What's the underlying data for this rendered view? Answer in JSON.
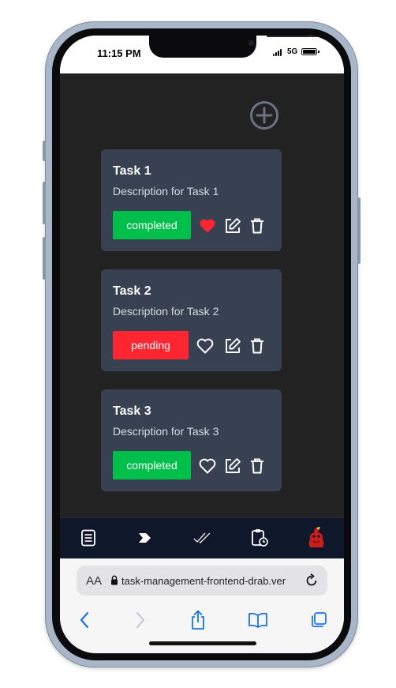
{
  "status_bar": {
    "time": "11:15 PM",
    "network": "5G"
  },
  "tasks": [
    {
      "title": "Task 1",
      "description": "Description for Task 1",
      "status": "completed",
      "favorited": true
    },
    {
      "title": "Task 2",
      "description": "Description for Task 2",
      "status": "pending",
      "favorited": false
    },
    {
      "title": "Task 3",
      "description": "Description for Task 3",
      "status": "completed",
      "favorited": false
    }
  ],
  "icons": {
    "add": "plus-circle-icon",
    "favorite": "heart-icon",
    "edit": "edit-icon",
    "delete": "trash-icon",
    "nav": [
      "document-list-icon",
      "chevron-right-icon",
      "double-check-icon",
      "clipboard-clock-icon",
      "avatar-icon"
    ]
  },
  "colors": {
    "completed": "#00c04b",
    "pending": "#ff2632",
    "favorite": "#ff2632",
    "card": "#374151",
    "background": "#222222",
    "nav": "#0f172a"
  },
  "browser": {
    "text_size_label": "AA",
    "url": "task-management-frontend-drab.ver"
  }
}
